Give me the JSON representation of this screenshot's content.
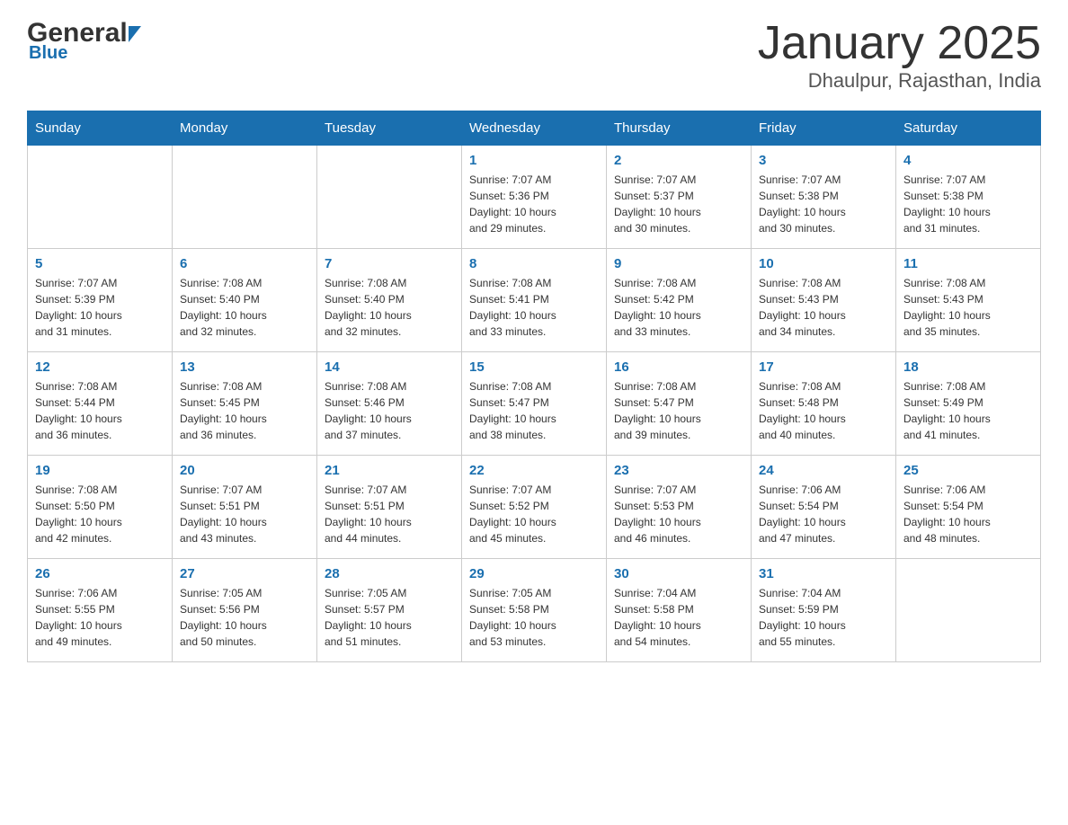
{
  "logo": {
    "name_black": "General",
    "arrow": "▶",
    "name_blue": "Blue"
  },
  "title": "January 2025",
  "subtitle": "Dhaulpur, Rajasthan, India",
  "days_of_week": [
    "Sunday",
    "Monday",
    "Tuesday",
    "Wednesday",
    "Thursday",
    "Friday",
    "Saturday"
  ],
  "weeks": [
    [
      {
        "day": "",
        "info": ""
      },
      {
        "day": "",
        "info": ""
      },
      {
        "day": "",
        "info": ""
      },
      {
        "day": "1",
        "info": "Sunrise: 7:07 AM\nSunset: 5:36 PM\nDaylight: 10 hours\nand 29 minutes."
      },
      {
        "day": "2",
        "info": "Sunrise: 7:07 AM\nSunset: 5:37 PM\nDaylight: 10 hours\nand 30 minutes."
      },
      {
        "day": "3",
        "info": "Sunrise: 7:07 AM\nSunset: 5:38 PM\nDaylight: 10 hours\nand 30 minutes."
      },
      {
        "day": "4",
        "info": "Sunrise: 7:07 AM\nSunset: 5:38 PM\nDaylight: 10 hours\nand 31 minutes."
      }
    ],
    [
      {
        "day": "5",
        "info": "Sunrise: 7:07 AM\nSunset: 5:39 PM\nDaylight: 10 hours\nand 31 minutes."
      },
      {
        "day": "6",
        "info": "Sunrise: 7:08 AM\nSunset: 5:40 PM\nDaylight: 10 hours\nand 32 minutes."
      },
      {
        "day": "7",
        "info": "Sunrise: 7:08 AM\nSunset: 5:40 PM\nDaylight: 10 hours\nand 32 minutes."
      },
      {
        "day": "8",
        "info": "Sunrise: 7:08 AM\nSunset: 5:41 PM\nDaylight: 10 hours\nand 33 minutes."
      },
      {
        "day": "9",
        "info": "Sunrise: 7:08 AM\nSunset: 5:42 PM\nDaylight: 10 hours\nand 33 minutes."
      },
      {
        "day": "10",
        "info": "Sunrise: 7:08 AM\nSunset: 5:43 PM\nDaylight: 10 hours\nand 34 minutes."
      },
      {
        "day": "11",
        "info": "Sunrise: 7:08 AM\nSunset: 5:43 PM\nDaylight: 10 hours\nand 35 minutes."
      }
    ],
    [
      {
        "day": "12",
        "info": "Sunrise: 7:08 AM\nSunset: 5:44 PM\nDaylight: 10 hours\nand 36 minutes."
      },
      {
        "day": "13",
        "info": "Sunrise: 7:08 AM\nSunset: 5:45 PM\nDaylight: 10 hours\nand 36 minutes."
      },
      {
        "day": "14",
        "info": "Sunrise: 7:08 AM\nSunset: 5:46 PM\nDaylight: 10 hours\nand 37 minutes."
      },
      {
        "day": "15",
        "info": "Sunrise: 7:08 AM\nSunset: 5:47 PM\nDaylight: 10 hours\nand 38 minutes."
      },
      {
        "day": "16",
        "info": "Sunrise: 7:08 AM\nSunset: 5:47 PM\nDaylight: 10 hours\nand 39 minutes."
      },
      {
        "day": "17",
        "info": "Sunrise: 7:08 AM\nSunset: 5:48 PM\nDaylight: 10 hours\nand 40 minutes."
      },
      {
        "day": "18",
        "info": "Sunrise: 7:08 AM\nSunset: 5:49 PM\nDaylight: 10 hours\nand 41 minutes."
      }
    ],
    [
      {
        "day": "19",
        "info": "Sunrise: 7:08 AM\nSunset: 5:50 PM\nDaylight: 10 hours\nand 42 minutes."
      },
      {
        "day": "20",
        "info": "Sunrise: 7:07 AM\nSunset: 5:51 PM\nDaylight: 10 hours\nand 43 minutes."
      },
      {
        "day": "21",
        "info": "Sunrise: 7:07 AM\nSunset: 5:51 PM\nDaylight: 10 hours\nand 44 minutes."
      },
      {
        "day": "22",
        "info": "Sunrise: 7:07 AM\nSunset: 5:52 PM\nDaylight: 10 hours\nand 45 minutes."
      },
      {
        "day": "23",
        "info": "Sunrise: 7:07 AM\nSunset: 5:53 PM\nDaylight: 10 hours\nand 46 minutes."
      },
      {
        "day": "24",
        "info": "Sunrise: 7:06 AM\nSunset: 5:54 PM\nDaylight: 10 hours\nand 47 minutes."
      },
      {
        "day": "25",
        "info": "Sunrise: 7:06 AM\nSunset: 5:54 PM\nDaylight: 10 hours\nand 48 minutes."
      }
    ],
    [
      {
        "day": "26",
        "info": "Sunrise: 7:06 AM\nSunset: 5:55 PM\nDaylight: 10 hours\nand 49 minutes."
      },
      {
        "day": "27",
        "info": "Sunrise: 7:05 AM\nSunset: 5:56 PM\nDaylight: 10 hours\nand 50 minutes."
      },
      {
        "day": "28",
        "info": "Sunrise: 7:05 AM\nSunset: 5:57 PM\nDaylight: 10 hours\nand 51 minutes."
      },
      {
        "day": "29",
        "info": "Sunrise: 7:05 AM\nSunset: 5:58 PM\nDaylight: 10 hours\nand 53 minutes."
      },
      {
        "day": "30",
        "info": "Sunrise: 7:04 AM\nSunset: 5:58 PM\nDaylight: 10 hours\nand 54 minutes."
      },
      {
        "day": "31",
        "info": "Sunrise: 7:04 AM\nSunset: 5:59 PM\nDaylight: 10 hours\nand 55 minutes."
      },
      {
        "day": "",
        "info": ""
      }
    ]
  ]
}
